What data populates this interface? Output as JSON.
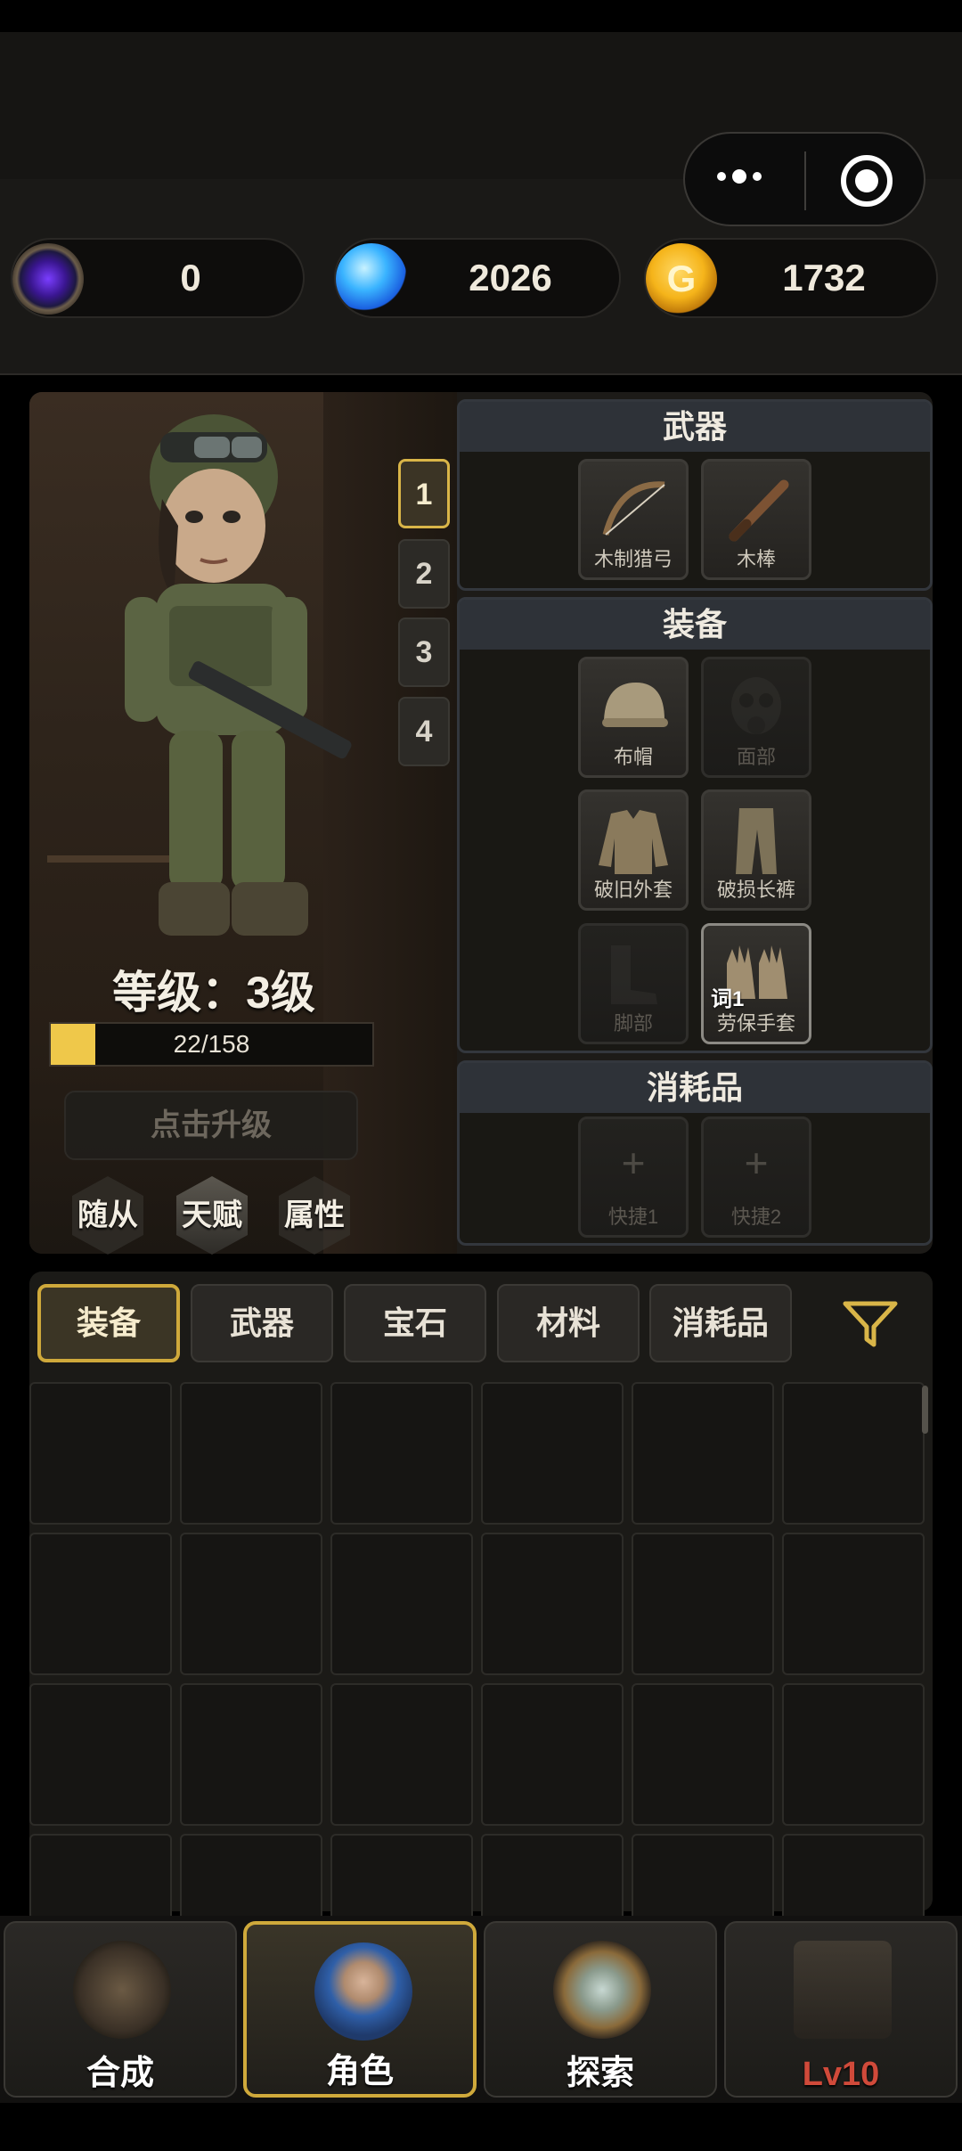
{
  "resources": {
    "void_stone": "0",
    "diamond": "2026",
    "gold": "1732"
  },
  "character": {
    "level_text": "等级：3级",
    "xp_text": "22/158",
    "xp_progress": 0.139,
    "upgrade_label": "点击升级",
    "loadout_slots": [
      "1",
      "2",
      "3",
      "4"
    ],
    "active_slot": "1",
    "sub_tabs": [
      "随从",
      "天赋",
      "属性"
    ],
    "active_sub_tab": "天赋"
  },
  "weapons_section": {
    "title": "武器",
    "items": [
      "木制猎弓",
      "木棒"
    ]
  },
  "equipment_section": {
    "title": "装备",
    "items": [
      "布帽",
      "面部",
      "破旧外套",
      "破损长裤",
      "脚部",
      "劳保手套"
    ],
    "empty_slots": [
      "面部",
      "脚部"
    ],
    "badge": "词1"
  },
  "consumables_section": {
    "title": "消耗品",
    "items": [
      "快捷1",
      "快捷2"
    ]
  },
  "inventory": {
    "tabs": [
      "装备",
      "武器",
      "宝石",
      "材料",
      "消耗品"
    ],
    "active_tab": "装备"
  },
  "bottom_nav": {
    "items": [
      "合成",
      "角色",
      "探索",
      "Lv10"
    ],
    "active": "角色",
    "locked": "Lv10"
  },
  "colors": {
    "accent_gold": "#cfa93b",
    "xp_fill": "#efc84a",
    "locked_red": "#d04a3a"
  }
}
